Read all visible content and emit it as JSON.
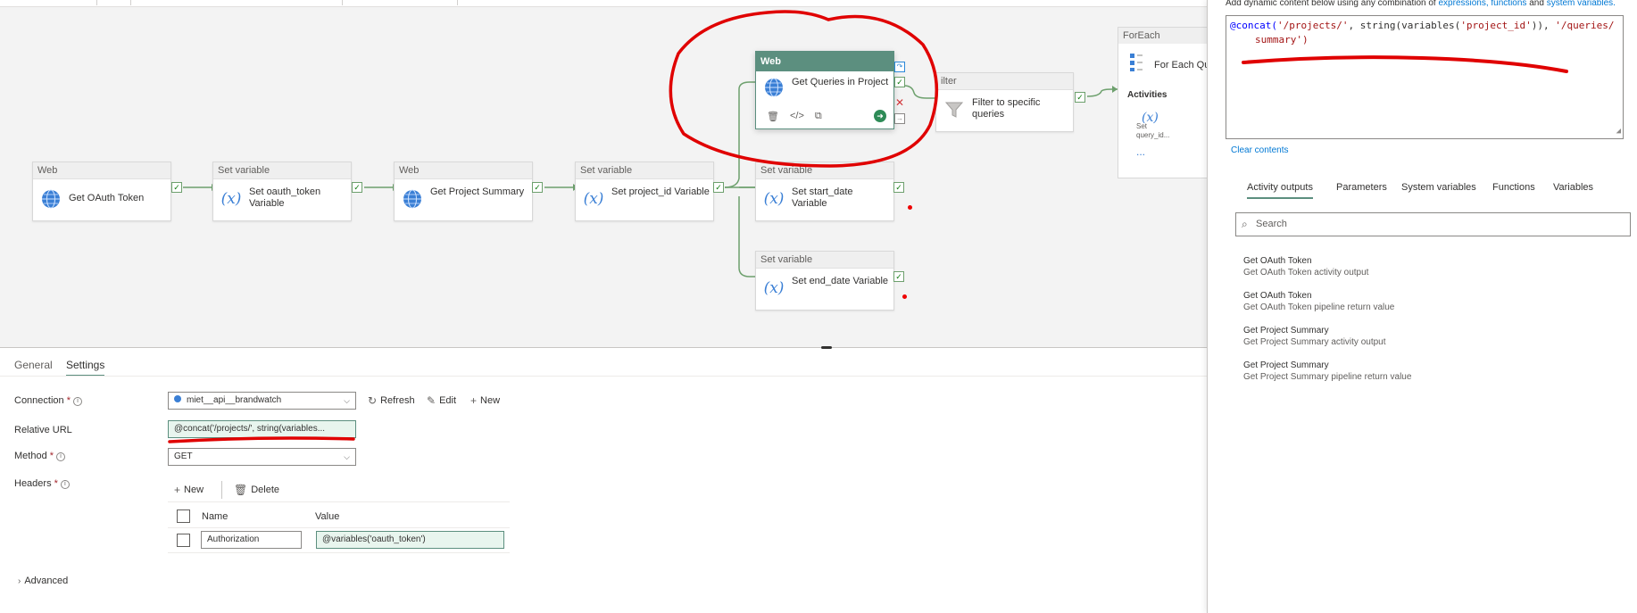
{
  "pipeline": {
    "nodes": {
      "get_oauth": {
        "type": "Web",
        "label": "Get OAuth Token"
      },
      "set_oauth": {
        "type": "Set variable",
        "label": "Set oauth_token Variable"
      },
      "get_project": {
        "type": "Web",
        "label": "Get Project Summary"
      },
      "set_project_id": {
        "type": "Set variable",
        "label": "Set project_id Variable"
      },
      "get_queries": {
        "type": "Web",
        "label": "Get Queries in Project"
      },
      "set_start": {
        "type": "Set variable",
        "label": "Set start_date Variable"
      },
      "set_end": {
        "type": "Set variable",
        "label": "Set end_date Variable"
      },
      "filter": {
        "type": "Filter",
        "type_visible": "ilter",
        "label": "Filter to specific queries"
      },
      "foreach": {
        "type": "ForEach",
        "label": "For Each Que",
        "activities_label": "Activities",
        "sub_label": "Set query_id...",
        "more": "..."
      }
    }
  },
  "bottom_panel": {
    "tabs": [
      {
        "label": "General"
      },
      {
        "label": "Settings"
      }
    ],
    "connection": {
      "label": "Connection",
      "value": "miet__api__brandwatch",
      "refresh": "Refresh",
      "edit": "Edit",
      "new": "New"
    },
    "relative_url": {
      "label": "Relative URL",
      "value": "@concat('/projects/', string(variables..."
    },
    "method": {
      "label": "Method",
      "value": "GET"
    },
    "headers": {
      "label": "Headers",
      "new": "New",
      "delete": "Delete",
      "columns": {
        "name": "Name",
        "value": "Value"
      },
      "rows": [
        {
          "name": "Authorization",
          "value": "@variables('oauth_token')"
        }
      ]
    },
    "advanced": "Advanced"
  },
  "right_panel": {
    "intro_text": "Add dynamic content below using any combination of",
    "intro_link1": "expressions, functions",
    "intro_and": "and",
    "intro_link2": "system variables.",
    "expression_line1_a": "@concat(",
    "expression_line1_b": "'/projects/'",
    "expression_line1_c": ", string(variables(",
    "expression_line1_d": "'project_id'",
    "expression_line1_e": ")), ",
    "expression_line1_f": "'/queries/",
    "expression_line2": "summary')",
    "clear": "Clear contents",
    "tabs": [
      {
        "label": "Activity outputs"
      },
      {
        "label": "Parameters"
      },
      {
        "label": "System variables"
      },
      {
        "label": "Functions"
      },
      {
        "label": "Variables"
      }
    ],
    "search_placeholder": "Search",
    "outputs": [
      {
        "title": "Get OAuth Token",
        "sub": "Get OAuth Token activity output"
      },
      {
        "title": "Get OAuth Token",
        "sub": "Get OAuth Token pipeline return value"
      },
      {
        "title": "Get Project Summary",
        "sub": "Get Project Summary activity output"
      },
      {
        "title": "Get Project Summary",
        "sub": "Get Project Summary pipeline return value"
      }
    ]
  },
  "icons": {
    "web": "globe-icon",
    "set_variable": "variable-x-icon",
    "filter": "funnel-icon",
    "delete": "trash-icon",
    "code": "code-icon",
    "copy": "copy-icon",
    "go": "arrow-circle-icon",
    "search": "search-icon",
    "refresh": "refresh-icon",
    "edit": "pencil-icon",
    "add": "plus-icon",
    "chevron": "chevron-down-icon",
    "info": "info-icon"
  },
  "colors": {
    "accent": "#5c8f7f",
    "success": "#107c10",
    "annotation": "#e00000",
    "link": "#0078d4"
  }
}
